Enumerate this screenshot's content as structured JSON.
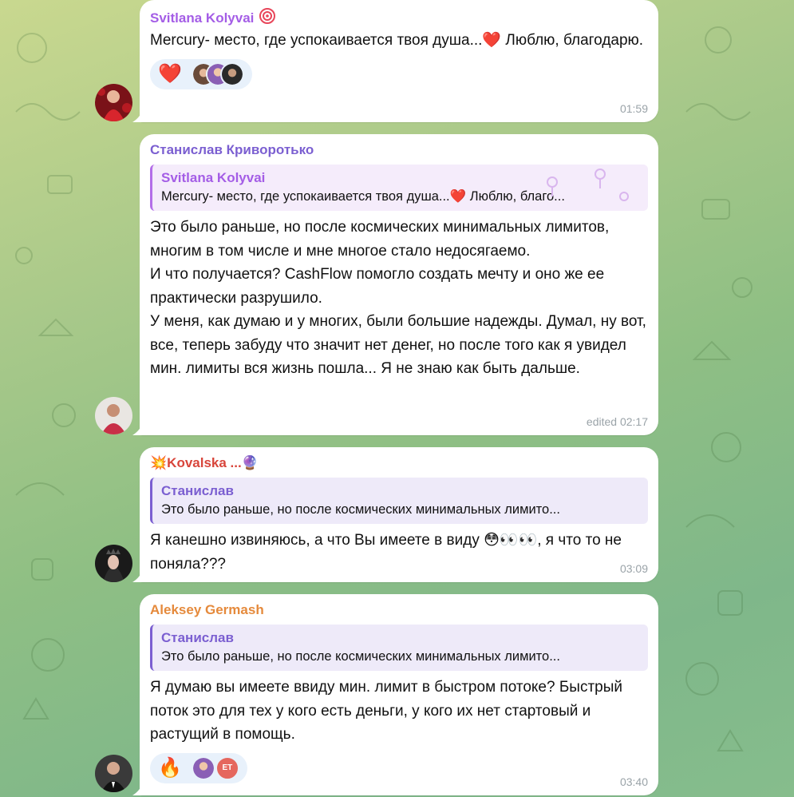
{
  "messages": [
    {
      "sender": "Svitlana Kolyvai",
      "sender_color": "#a45de6",
      "badge_icon": "spiral-badge-icon",
      "text": "Mercury- место, где успокаивается твоя душа...❤️ Люблю, благодарю.",
      "reaction_emoji": "❤️",
      "time": "01:59"
    },
    {
      "sender": "Станислав Криворотько",
      "sender_color": "#7b5fd1",
      "reply_name": "Svitlana Kolyvai",
      "reply_text": "Mercury- место, где успокаивается твоя душа...❤️ Люблю, благо...",
      "text_lines": [
        "Это было раньше, но после космических минимальных лимитов, многим в том числе и мне многое стало недосягаемо.",
        "И что получается? CashFlow помогло создать мечту и оно же ее практически разрушило.",
        "У меня, как думаю и у многих, были большие надежды. Думал, ну вот, все, теперь забуду что значит нет денег, но после того как я увидел мин. лимиты вся жизнь пошла... Я не знаю как быть дальше."
      ],
      "time": "edited 02:17"
    },
    {
      "sender": "💥Kovalska ...🔮",
      "sender_color": "#d8453b",
      "reply_name": "Станислав",
      "reply_text": "Это было раньше, но после космических минимальных лимито...",
      "text": "Я канешно извиняюсь, а что Вы имеете в виду 😳👀👀, я что то не поняла???",
      "time": "03:09"
    },
    {
      "sender": "Aleksey Germash",
      "sender_color": "#e58a3c",
      "reply_name": "Станислав",
      "reply_text": "Это было раньше, но после космических минимальных лимито...",
      "text": "Я думаю вы имеете ввиду мин. лимит в быстром потоке? Быстрый поток это для тех у кого есть деньги, у кого их нет стартовый и растущий в помощь.",
      "reaction_emoji": "🔥",
      "reaction_avatar_text": "ET",
      "time": "03:40"
    }
  ],
  "colors": {
    "reply_accent": "#7b5fd1",
    "reply_accent_pink": "#b36ee8",
    "reaction_bg": "#e8f1fb"
  }
}
